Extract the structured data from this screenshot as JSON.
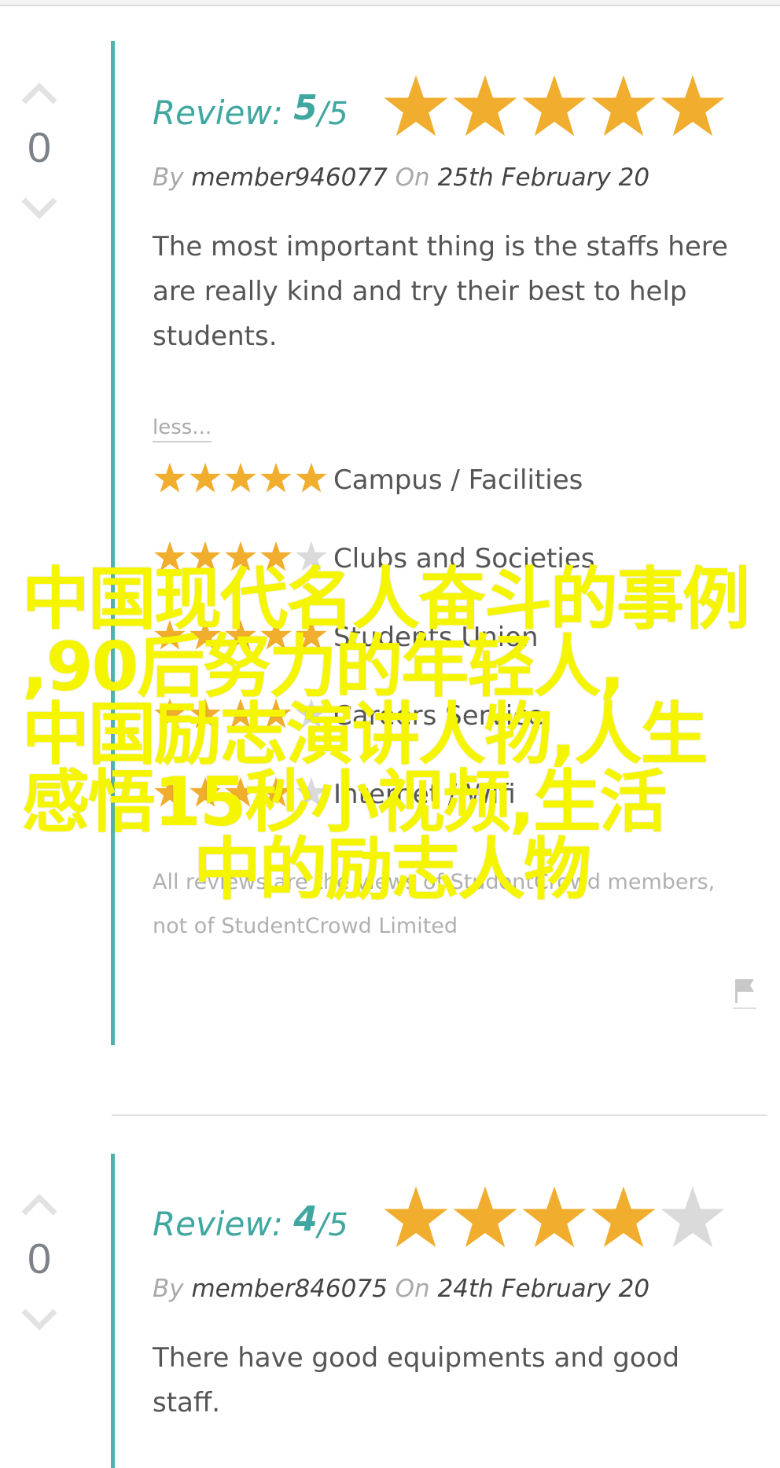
{
  "colors": {
    "accent": "#3fa7a0",
    "star_filled": "#f0ad2e",
    "star_empty": "#dadada",
    "overlay_text": "#f5f500"
  },
  "reviews": [
    {
      "vote_count": "0",
      "review_label": "Review:",
      "score": "5",
      "out_of": "/5",
      "rating": 5,
      "by_label": "By",
      "author": "member946077",
      "on_label": "On",
      "date": "25th February 20",
      "text": "The most important thing is the staffs here are really kind and try their best to help students.",
      "less_link": "less...",
      "categories": [
        {
          "label": "Campus / Facilities",
          "rating": 5
        },
        {
          "label": "Clubs and Societies",
          "rating": 4
        },
        {
          "label": "Students Union",
          "rating": 5
        },
        {
          "label": "Careers Service",
          "rating": 4
        },
        {
          "label": "Internet / Wifi",
          "rating": 4
        }
      ],
      "disclaimer": "All reviews are the views of StudentCrowd members, not of StudentCrowd Limited"
    },
    {
      "vote_count": "0",
      "review_label": "Review:",
      "score": "4",
      "out_of": "/5",
      "rating": 4,
      "by_label": "By",
      "author": "member846075",
      "on_label": "On",
      "date": "24th February 20",
      "text": "There have good equipments and good staff."
    }
  ],
  "overlay": {
    "line1": "中国现代名人奋斗的事例",
    "line2": ",90后努力的年轻人,",
    "line3": "中国励志演讲人物,人生",
    "line4": "感悟15秒小视频,生活",
    "line5": "中的励志人物"
  },
  "icons": {
    "upvote": "chevron-up-icon",
    "downvote": "chevron-down-icon",
    "star": "star-icon",
    "flag": "flag-icon"
  }
}
